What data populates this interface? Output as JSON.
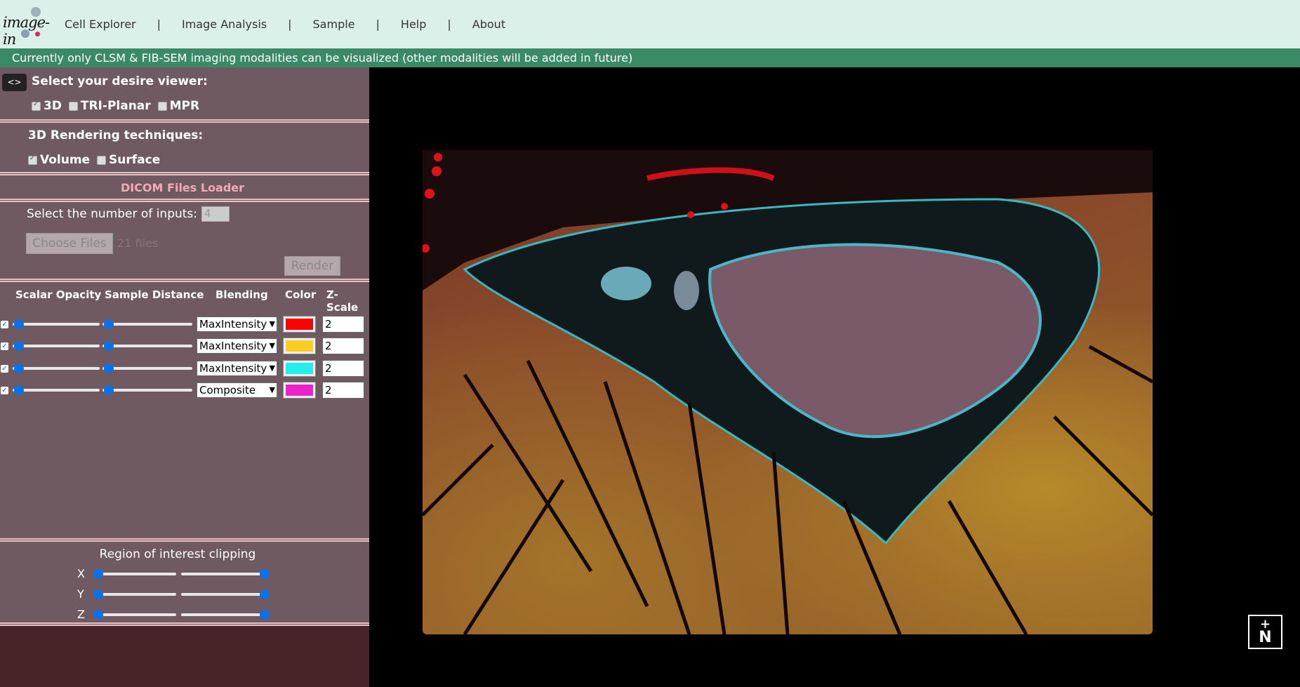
{
  "nav": {
    "logo_text": "image-in",
    "items": [
      "Cell Explorer",
      "Image Analysis",
      "Sample",
      "Help",
      "About"
    ],
    "separator": "|"
  },
  "banner": "Currently only CLSM & FIB-SEM imaging modalities can be visualized (other modalities will be added in future)",
  "viewer_select": {
    "toggle_label": "<>",
    "title": "Select your desire viewer:",
    "options": [
      {
        "label": "3D",
        "checked": true
      },
      {
        "label": "TRI-Planar",
        "checked": false
      },
      {
        "label": "MPR",
        "checked": false
      }
    ]
  },
  "rendering": {
    "title": "3D Rendering techniques:",
    "options": [
      {
        "label": "Volume",
        "checked": true
      },
      {
        "label": "Surface",
        "checked": false
      }
    ]
  },
  "loader": {
    "title": "DICOM Files Loader",
    "inputs_label": "Select the number of inputs:",
    "inputs_value": "4",
    "choose_label": "Choose Files",
    "files_text": "21 files",
    "render_label": "Render"
  },
  "channels": {
    "headers": [
      "Scalar Opacity",
      "Sample Distance",
      "Blending",
      "Color",
      "Z-Scale"
    ],
    "rows": [
      {
        "blending": "MaxIntensity",
        "color": "#ff0000",
        "zscale": "2"
      },
      {
        "blending": "MaxIntensity",
        "color": "#ffcc22",
        "zscale": "2"
      },
      {
        "blending": "MaxIntensity",
        "color": "#22eeee",
        "zscale": "2"
      },
      {
        "blending": "Composite",
        "color": "#ee22cc",
        "zscale": "2"
      }
    ]
  },
  "roi": {
    "title": "Region of interest clipping",
    "axes": [
      "X",
      "Y",
      "Z"
    ]
  },
  "badge_text": "N"
}
